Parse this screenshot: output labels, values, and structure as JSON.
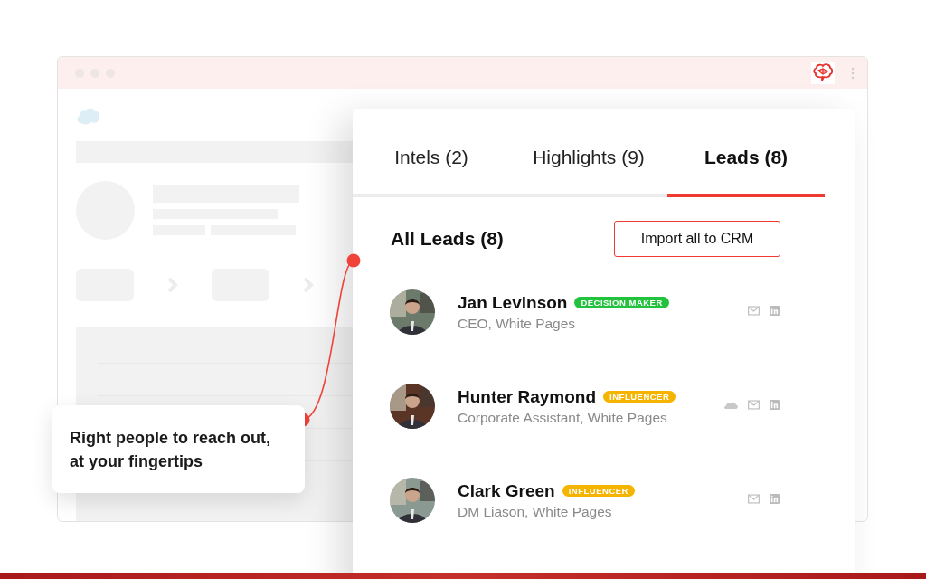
{
  "panel": {
    "tabs": [
      {
        "label": "Intels (2)",
        "selected": false
      },
      {
        "label": "Highlights (9)",
        "selected": false
      },
      {
        "label": "Leads (8)",
        "selected": true
      }
    ],
    "heading": "All Leads (8)",
    "import_button": "Import all to CRM",
    "leads": [
      {
        "name": "Jan Levinson",
        "tag": {
          "label": "DECISION MAKER",
          "color": "#22c23d"
        },
        "title": "CEO, White Pages",
        "contacts": [
          {
            "kind": "email"
          },
          {
            "kind": "linkedin"
          }
        ]
      },
      {
        "name": "Hunter Raymond",
        "tag": {
          "label": "INFLUENCER",
          "color": "#f5b400"
        },
        "title": "Corporate Assistant, White Pages",
        "contacts": [
          {
            "kind": "cloud"
          },
          {
            "kind": "email"
          },
          {
            "kind": "linkedin"
          }
        ]
      },
      {
        "name": "Clark Green",
        "tag": {
          "label": "INFLUENCER",
          "color": "#f5b400"
        },
        "title": "DM Liason, White Pages",
        "contacts": [
          {
            "kind": "email"
          },
          {
            "kind": "linkedin"
          }
        ]
      }
    ]
  },
  "callout": {
    "text": "Right people to reach out, at your fingertips"
  }
}
